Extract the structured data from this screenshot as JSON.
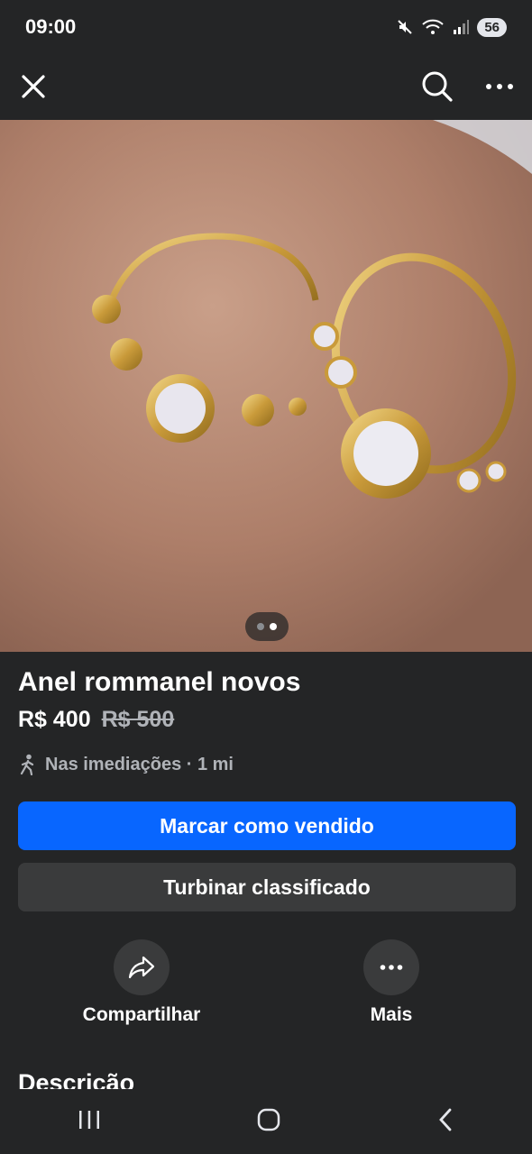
{
  "status_bar": {
    "time": "09:00",
    "battery": "56"
  },
  "listing": {
    "title": "Anel rommanel novos",
    "price": "R$ 400",
    "original_price": "R$ 500",
    "location": "Nas imediações · 1 mi",
    "photo_pager": {
      "count": 2,
      "active_index": 1
    }
  },
  "buttons": {
    "mark_sold": "Marcar como vendido",
    "boost": "Turbinar classificado"
  },
  "actions": {
    "share": "Compartilhar",
    "more": "Mais"
  },
  "section": {
    "description_heading": "Descrição"
  },
  "icons": {
    "close": "close-icon",
    "search": "search-icon",
    "more": "more-horizontal-icon",
    "share": "share-arrow-icon",
    "walk": "walking-person-icon"
  },
  "colors": {
    "primary": "#0866ff",
    "background": "#242526",
    "secondary_button": "#3a3b3c"
  }
}
